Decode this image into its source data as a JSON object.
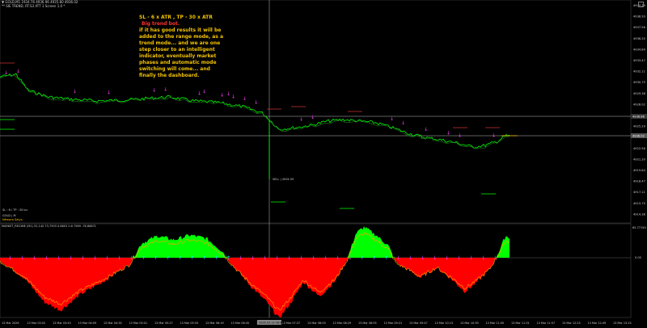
{
  "header": {
    "symbol_line": "▼ GOLD,M1 1934.76 4936.96 4935.80 4936.02",
    "info_line": "** SIE TREND, RT:S3 ATT 1 Screen 1.0 *"
  },
  "note": {
    "line1": "SL - 6 x ATR , TP - 30 x ATR",
    "line2": "Big trend bot.",
    "line3": "if it has good results it will be added to the range mode, as a trend mode... and we are one step closer to an intelligent indicator, eventually market phases and automatic mode switching will come... and finally the dashboard."
  },
  "labels": {
    "sl_tp": "SL : 6 / TP : 30 bu",
    "gold_label": "GOLD | M",
    "emo_label": "Nêmora Setys",
    "sl_marker": "SELL | 4934.55"
  },
  "indicator": {
    "header": "MARKET_REGIME (M1) 52,140 73,7903 0.8603 0.6 7969 -76.86871",
    "zero_label": "0.00",
    "top_label": "65.77150"
  },
  "price_axis": [
    "4940.29",
    "4938.93",
    "4937.56",
    "4936.20",
    "4934.84",
    "4933.47",
    "4932.11",
    "4930.75",
    "4929.38",
    "4928.02",
    "4926.65",
    "4925.29",
    "4923.93",
    "4922.56",
    "4921.20",
    "4919.84",
    "4918.47",
    "4917.11",
    "4915.75",
    "4914.38"
  ],
  "current_price": "4936.02",
  "price_tags": [
    "4936.86",
    "4936.02"
  ],
  "time_axis": [
    "13 Mar 2026",
    "13 Mar 03:02",
    "13 Mar 03:43",
    "13 Mar 04:09",
    "13 Mar 04:35",
    "13 Mar 05:01",
    "13 Mar 05:27",
    "13 Mar 05:53",
    "13 Mar 06:19",
    "13 Mar 06:45",
    "13 Mar 07:11",
    "13 Mar 07:37",
    "13 Mar 08:03",
    "13 Mar 08:29",
    "13 Mar 08:55",
    "13 Mar 09:21",
    "13 Mar 09:47",
    "13 Mar 10:13",
    "13 Mar 10:39",
    "13 Mar 11:05",
    "13 Mar 11:31",
    "13 Mar 11:57",
    "13 Mar 12:23",
    "13 Mar 12:49",
    "13 Mar 13:15"
  ],
  "time_tag": "2026.03.13 08:06",
  "colors": {
    "background": "#000000",
    "bull": "#00ff00",
    "bear": "#ff0000",
    "signal": "#ff40ff",
    "cyan": "#00e5ff",
    "grid": "#1a1a1a",
    "note": "#f2c200"
  }
}
